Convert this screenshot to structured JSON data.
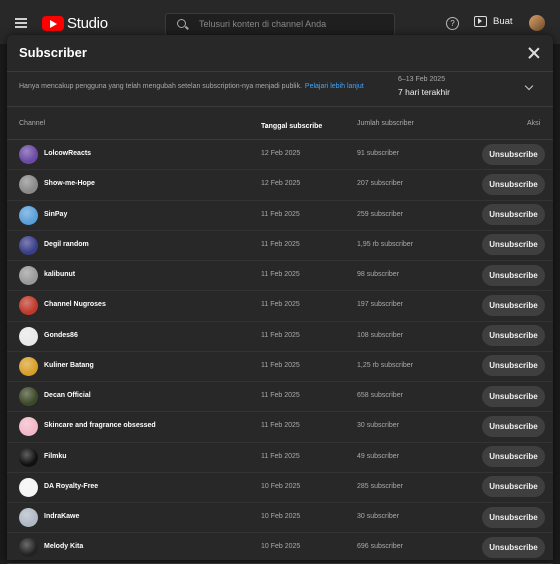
{
  "topbar": {
    "logo_text": "Studio",
    "search_placeholder": "Telusuri konten di channel Anda",
    "create_label": "Buat"
  },
  "modal": {
    "title": "Subscriber",
    "description": "Hanya mencakup pengguna yang telah mengubah setelan subscription-nya menjadi publik.",
    "learn_more": "Pelajari lebih lanjut",
    "date_range": "6–13 Feb 2025",
    "period": "7 hari terakhir"
  },
  "table": {
    "headers": {
      "channel": "Channel",
      "date": "Tanggal subscribe",
      "count": "Jumlah subscriber",
      "action": "Aksi"
    },
    "rows": [
      {
        "name": "LolcowReacts",
        "date": "12 Feb 2025",
        "count": "91 subscriber",
        "action": "Unsubscribe",
        "avatar_color": "#6a4aa5"
      },
      {
        "name": "Show-me-Hope",
        "date": "12 Feb 2025",
        "count": "207 subscriber",
        "action": "Unsubscribe",
        "avatar_color": "#8a8a8a"
      },
      {
        "name": "SinPay",
        "date": "11 Feb 2025",
        "count": "259 subscriber",
        "action": "Unsubscribe",
        "avatar_color": "#5aa0d8"
      },
      {
        "name": "Degil random",
        "date": "11 Feb 2025",
        "count": "1,95 rb subscriber",
        "action": "Unsubscribe",
        "avatar_color": "#3b3f8a"
      },
      {
        "name": "kalibunut",
        "date": "11 Feb 2025",
        "count": "98 subscriber",
        "action": "Unsubscribe",
        "avatar_color": "#9a9a9a"
      },
      {
        "name": "Channel Nugroses",
        "date": "11 Feb 2025",
        "count": "197 subscriber",
        "action": "Unsubscribe",
        "avatar_color": "#c0392b"
      },
      {
        "name": "Gondes86",
        "date": "11 Feb 2025",
        "count": "108 subscriber",
        "action": "Unsubscribe",
        "avatar_color": "#e8e8e8"
      },
      {
        "name": "Kuliner Batang",
        "date": "11 Feb 2025",
        "count": "1,25 rb subscriber",
        "action": "Unsubscribe",
        "avatar_color": "#d8a02a"
      },
      {
        "name": "Decan Official",
        "date": "11 Feb 2025",
        "count": "658 subscriber",
        "action": "Unsubscribe",
        "avatar_color": "#3d4a2a"
      },
      {
        "name": "Skincare and fragrance obsessed",
        "date": "11 Feb 2025",
        "count": "30 subscriber",
        "action": "Unsubscribe",
        "avatar_color": "#f2b8c8"
      },
      {
        "name": "Filmku",
        "date": "11 Feb 2025",
        "count": "49 subscriber",
        "action": "Unsubscribe",
        "avatar_color": "#101010"
      },
      {
        "name": "DA Royalty-Free",
        "date": "10 Feb 2025",
        "count": "285 subscriber",
        "action": "Unsubscribe",
        "avatar_color": "#f5f5f5"
      },
      {
        "name": "IndraKawe",
        "date": "10 Feb 2025",
        "count": "30 subscriber",
        "action": "Unsubscribe",
        "avatar_color": "#b0b8c4"
      },
      {
        "name": "Melody Kita",
        "date": "10 Feb 2025",
        "count": "696 subscriber",
        "action": "Unsubscribe",
        "avatar_color": "#222222"
      }
    ]
  }
}
